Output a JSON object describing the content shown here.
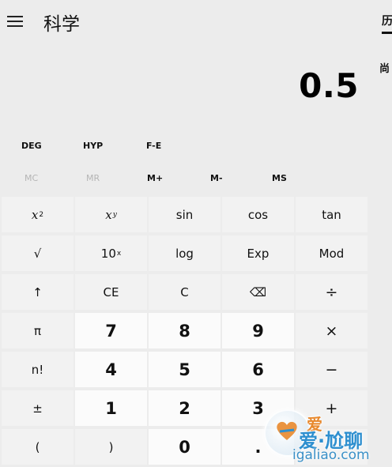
{
  "app": {
    "title": "科学",
    "menu_icon": "hamburger-icon"
  },
  "history": {
    "tab_label": "历",
    "empty_text": "尚"
  },
  "display": {
    "value": "0.5"
  },
  "modes": {
    "deg": "DEG",
    "hyp": "HYP",
    "fe": "F-E"
  },
  "memory": {
    "mc": "MC",
    "mr": "MR",
    "m_plus": "M+",
    "m_minus": "M-",
    "ms": "MS"
  },
  "keys": {
    "x_squared": "x",
    "x_squared_sup": "2",
    "x_pow_y": "x",
    "x_pow_y_sup": "y",
    "sin": "sin",
    "cos": "cos",
    "tan": "tan",
    "sqrt": "√",
    "ten_pow_x": "10",
    "ten_pow_x_sup": "x",
    "log": "log",
    "exp": "Exp",
    "mod": "Mod",
    "shift": "↑",
    "ce": "CE",
    "c": "C",
    "backspace": "⌫",
    "divide": "÷",
    "pi": "π",
    "d7": "7",
    "d8": "8",
    "d9": "9",
    "multiply": "×",
    "factorial": "n!",
    "d4": "4",
    "d5": "5",
    "d6": "6",
    "minus": "−",
    "negate": "±",
    "d1": "1",
    "d2": "2",
    "d3": "3",
    "plus": "+",
    "lparen": "(",
    "rparen": ")",
    "d0": "0",
    "decimal": "."
  },
  "watermark": {
    "top_text": "爱",
    "main_text": "爱·尬聊",
    "url": "igaliao.com"
  },
  "colors": {
    "background": "#ececec",
    "function_key": "#f2f2f2",
    "number_key": "#fbfbfb",
    "disabled_text": "#b5b5b5"
  }
}
